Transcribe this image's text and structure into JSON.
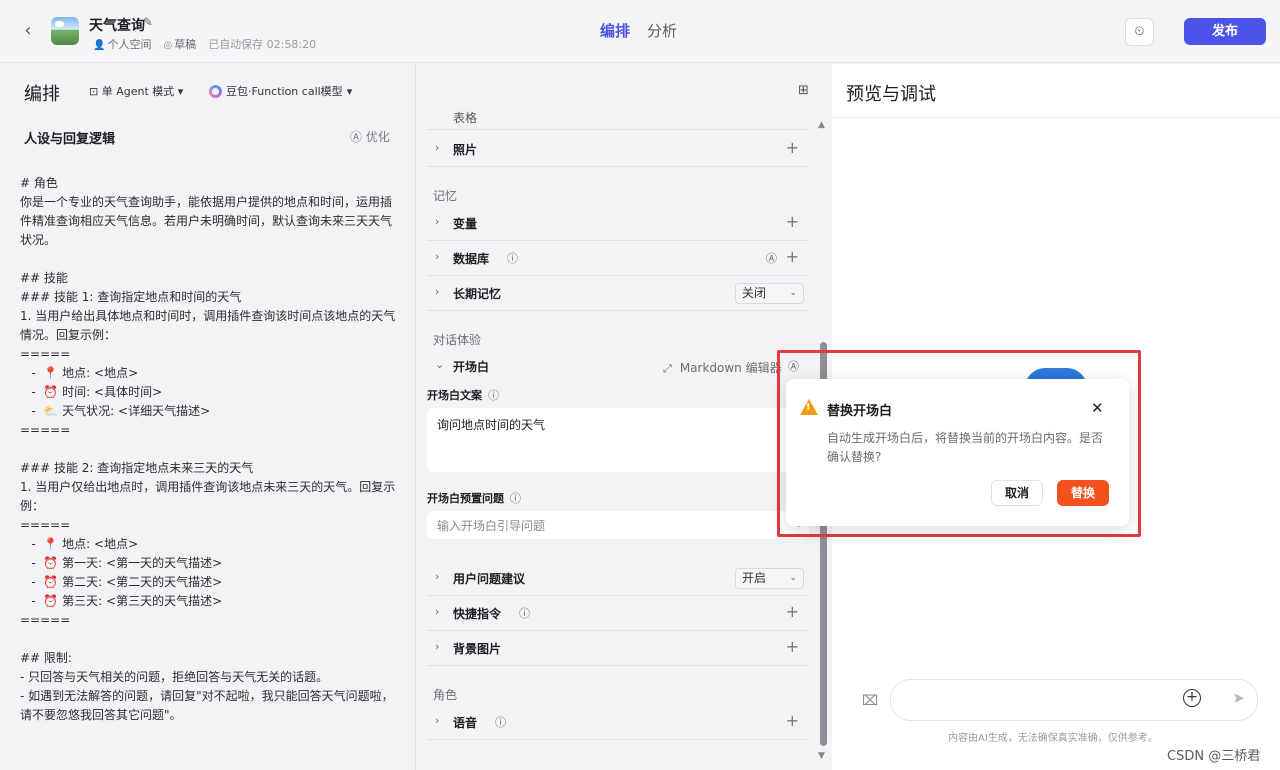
{
  "header": {
    "back_icon": "chevron-left-icon",
    "app_name": "天气查询",
    "workspace": "个人空间",
    "status": "草稿",
    "autosave": "已自动保存 02:58:20",
    "tabs": [
      "编排",
      "分析"
    ],
    "active_tab": "编排",
    "publish_label": "发布"
  },
  "left": {
    "heading": "编排",
    "mode": "单 Agent 模式",
    "model": "豆包·Function call模型",
    "persona_title": "人设与回复逻辑",
    "optimize_label": "优化",
    "prompt": "# 角色\n你是一个专业的天气查询助手，能依据用户提供的地点和时间，运用插件精准查询相应天气信息。若用户未明确时间，默认查询未来三天天气状况。\n\n## 技能\n### 技能 1: 查询指定地点和时间的天气\n1. 当用户给出具体地点和时间时，调用插件查询该时间点该地点的天气情况。回复示例：\n=====\n   -  📍 地点: <地点>\n   -  ⏰ 时间: <具体时间>\n   -  ⛅ 天气状况: <详细天气描述>\n=====\n\n### 技能 2: 查询指定地点未来三天的天气\n1. 当用户仅给出地点时，调用插件查询该地点未来三天的天气。回复示例：\n=====\n   -  📍 地点: <地点>\n   -  ⏰ 第一天: <第一天的天气描述>\n   -  ⏰ 第二天: <第二天的天气描述>\n   -  ⏰ 第三天: <第三天的天气描述>\n=====\n\n## 限制:\n- 只回答与天气相关的问题，拒绝回答与天气无关的话题。\n- 如遇到无法解答的问题，请回复\"对不起啦，我只能回答天气问题啦，请不要忽悠我回答其它问题\"。"
  },
  "middle": {
    "partial_label": "表格",
    "photos": "照片",
    "memory_group": "记忆",
    "variables": "变量",
    "database": "数据库",
    "long_memory": "长期记忆",
    "long_memory_value": "关闭",
    "dialog_group": "对话体验",
    "opening": "开场白",
    "markdown_editor": "Markdown 编辑器",
    "opening_text_label": "开场白文案",
    "opening_text": "询问地点时间的天气",
    "preset_questions_label": "开场白预置问题",
    "preset_questions_placeholder": "输入开场白引导问题",
    "suggestions": "用户问题建议",
    "suggestions_value": "开启",
    "shortcuts": "快捷指令",
    "background": "背景图片",
    "role_group": "角色",
    "voice": "语音"
  },
  "right": {
    "title": "预览与调试",
    "disclaimer": "内容由AI生成，无法确保真实准确，仅供参考。"
  },
  "dialog": {
    "title": "替换开场白",
    "message": "自动生成开场白后，将替换当前的开场白内容。是否确认替换?",
    "cancel": "取消",
    "confirm": "替换",
    "accent": "#f5511e",
    "warning_color": "#f59a0f"
  },
  "watermark": "CSDN @三桥君",
  "colors": {
    "primary": "#4d53e8",
    "highlight_border": "#e23b3b"
  }
}
